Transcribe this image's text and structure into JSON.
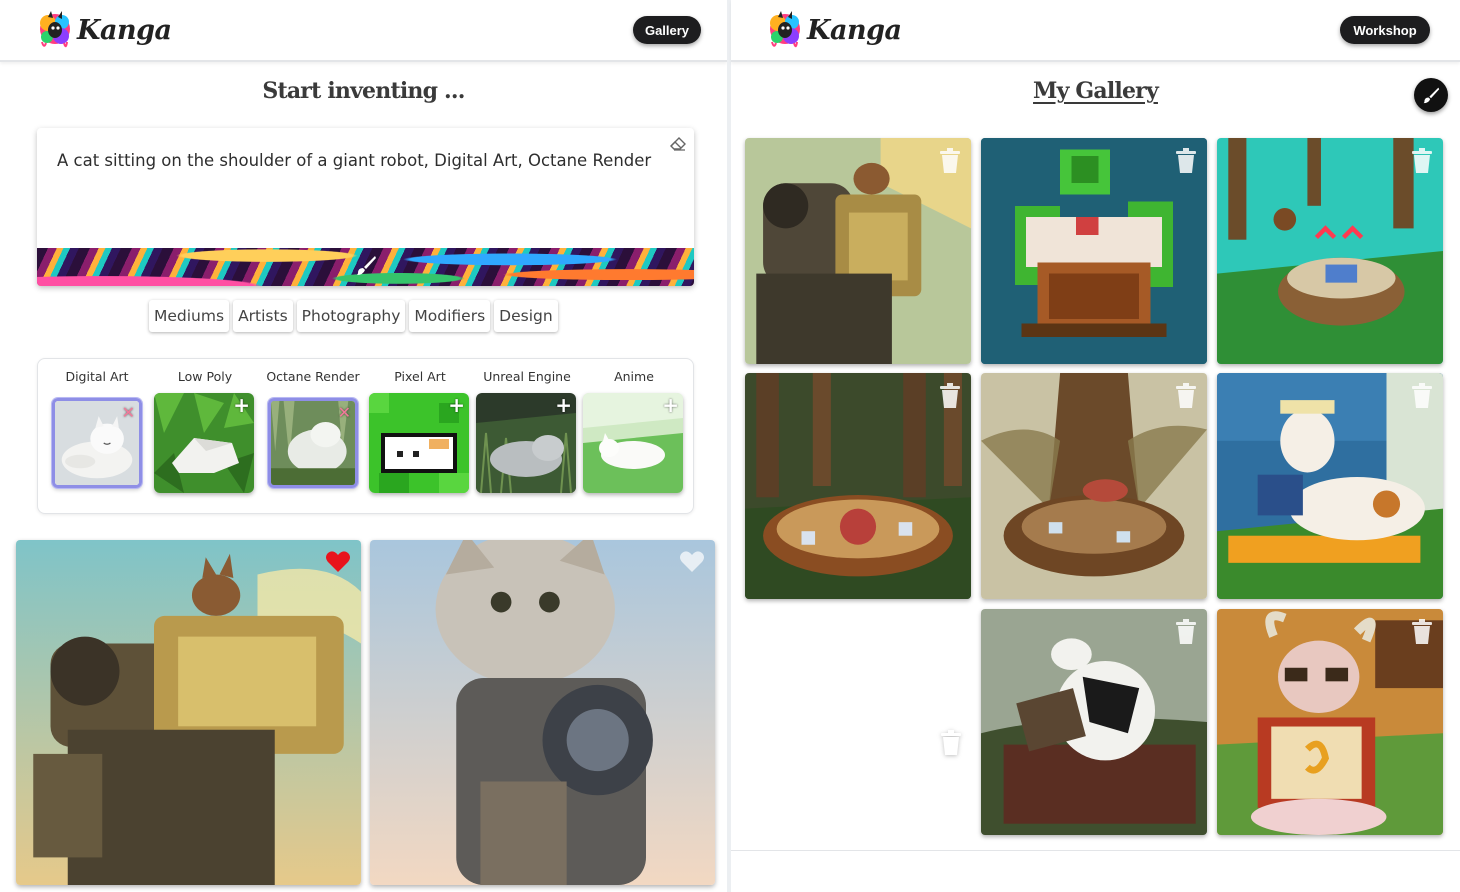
{
  "workshop": {
    "brand": "Kanga",
    "nav_button": "Gallery",
    "heading": "Start inventing ...",
    "prompt_text": "A cat sitting on the shoulder of a giant robot, Digital Art, Octane Render",
    "tabs": [
      "Mediums",
      "Artists",
      "Photography",
      "Modifiers",
      "Design"
    ],
    "styles": [
      {
        "label": "Digital Art",
        "selected": true
      },
      {
        "label": "Low Poly",
        "selected": false
      },
      {
        "label": "Octane Render",
        "selected": true
      },
      {
        "label": "Pixel Art",
        "selected": false
      },
      {
        "label": "Unreal Engine",
        "selected": false
      },
      {
        "label": "Anime",
        "selected": false
      }
    ],
    "results": [
      {
        "liked": true,
        "icon": "heart-icon"
      },
      {
        "liked": false,
        "icon": "heart-icon"
      }
    ]
  },
  "gallery": {
    "brand": "Kanga",
    "nav_button": "Workshop",
    "heading": "My Gallery",
    "paint_icon": "paintbrush-icon",
    "tile_count": 8,
    "delete_icon": "trash-icon"
  },
  "colors": {
    "pill": "#1d1d1f",
    "selected_outline": "#8e8ee6",
    "heart_liked": "#e8141c",
    "pixel_teal": "#1f6075"
  }
}
